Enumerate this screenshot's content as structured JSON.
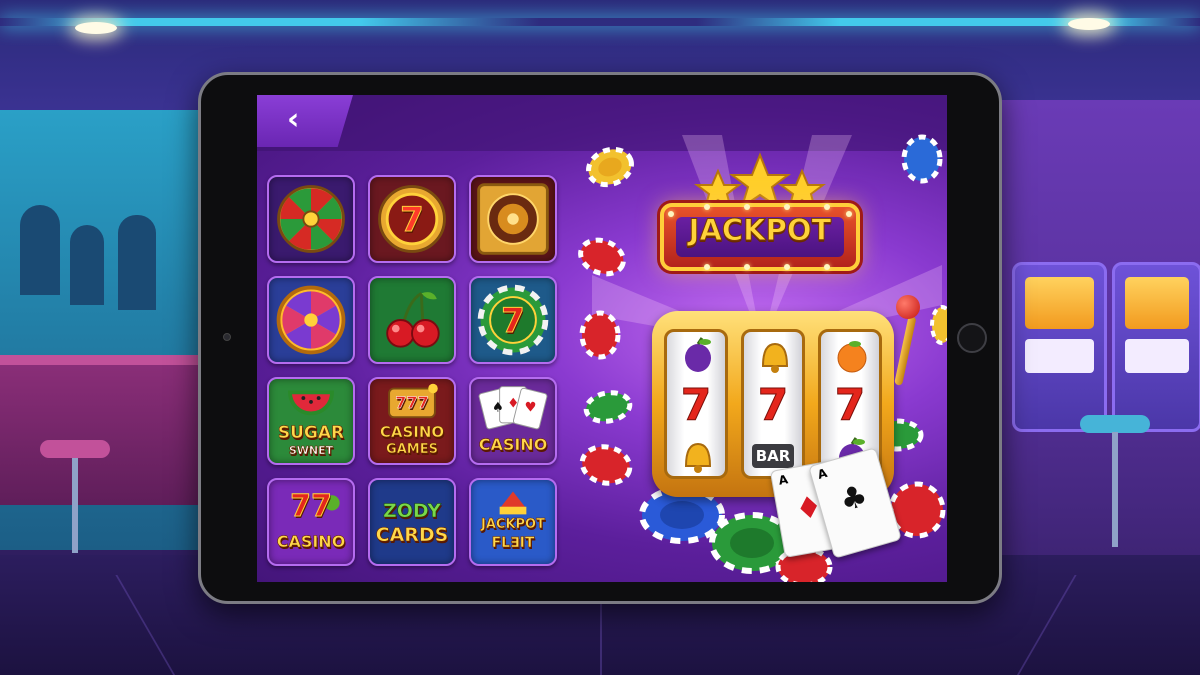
{
  "navigation": {
    "back_label": "‹"
  },
  "games": [
    {
      "label": "",
      "icon": "wheel-of-fortune-icon"
    },
    {
      "label": "7",
      "icon": "lucky-seven-roulette-icon"
    },
    {
      "label": "",
      "icon": "roulette-icon"
    },
    {
      "label": "",
      "icon": "prize-wheel-icon"
    },
    {
      "label": "",
      "icon": "cherries-icon"
    },
    {
      "label": "7",
      "icon": "seven-chip-icon"
    },
    {
      "label_line1": "SUGAR",
      "label_line2": "SWNEТ",
      "icon": "watermelon-icon"
    },
    {
      "label_top": "777",
      "label_line1": "CASINO",
      "label_line2": "GAMES",
      "icon": "slot-machine-icon"
    },
    {
      "label": "CASINO",
      "icon": "playing-cards-icon"
    },
    {
      "label_top": "77",
      "label": "CASINO",
      "icon": "lucky-sevens-icon"
    },
    {
      "label_line1": "ZODY",
      "label_line2": "CARDS",
      "icon": "zody-cards-icon"
    },
    {
      "label_line1": "JACKPOT",
      "label_line2": "FL∃IT",
      "icon": "circus-tent-icon"
    }
  ],
  "featured": {
    "sign": "JACKPOT",
    "reels": {
      "top": [
        "plum",
        "bell",
        "orange"
      ],
      "middle": [
        "7",
        "7",
        "7"
      ],
      "bottom": [
        "bell",
        "BAR",
        "plum"
      ]
    },
    "cards": [
      {
        "rank": "A",
        "suit": "♦"
      },
      {
        "rank": "A",
        "suit": "♣"
      }
    ]
  },
  "colors": {
    "screen_bg": "#6a2aab",
    "tile_border": "#b56cf0",
    "gold": "#ffd23a",
    "red_seven": "#e4261c"
  }
}
